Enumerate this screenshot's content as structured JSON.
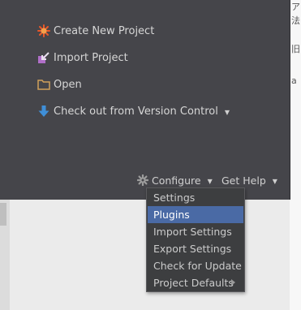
{
  "background_text": [
    "ア",
    "法",
    "旧",
    "a"
  ],
  "actions": [
    {
      "label": "Create New Project",
      "icon": "starburst-icon",
      "color": "#e8572a"
    },
    {
      "label": "Import Project",
      "icon": "import-arrow-icon",
      "color": "#b06fc8"
    },
    {
      "label": "Open",
      "icon": "folder-icon",
      "color": "#d2a15a"
    },
    {
      "label": "Check out from Version Control",
      "icon": "down-arrow-icon",
      "color": "#3f8fd8",
      "has_dropdown": true
    }
  ],
  "footer": {
    "configure_label": "Configure",
    "get_help_label": "Get Help"
  },
  "configure_menu": {
    "items": [
      {
        "label": "Settings",
        "selected": false
      },
      {
        "label": "Plugins",
        "selected": true
      },
      {
        "label": "Import Settings",
        "selected": false
      },
      {
        "label": "Export Settings",
        "selected": false
      },
      {
        "label": "Check for Update",
        "selected": false
      },
      {
        "label": "Project Defaults",
        "selected": false,
        "has_submenu": true
      }
    ]
  },
  "colors": {
    "panel_bg": "#45454a",
    "menu_bg": "#3d3e40",
    "selection": "#4a6aa5"
  }
}
